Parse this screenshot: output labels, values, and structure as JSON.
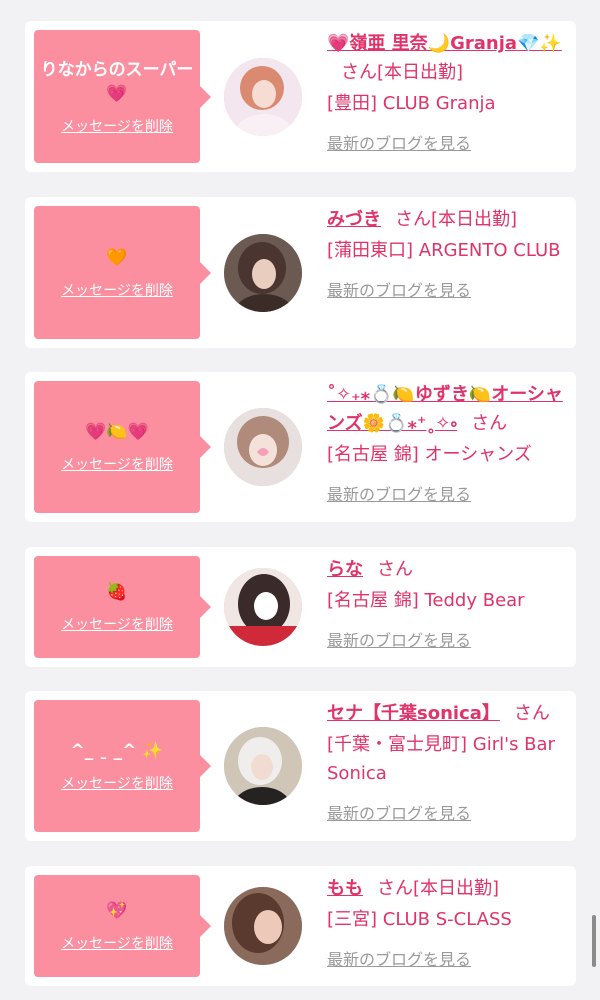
{
  "cards": [
    {
      "message": "りなからのスーパー💗",
      "delete_label": "メッセージを削除",
      "name": "💗嶺亜 里奈🌙Granja💎✨",
      "honorific": "さん",
      "status": "[本日出勤]",
      "shop": "[豊田] CLUB Granja",
      "blog_label": "最新のブログを見る",
      "avatar_icon": "profile-photo-icon"
    },
    {
      "message": "🧡",
      "delete_label": "メッセージを削除",
      "name": "みづき",
      "honorific": "さん",
      "status": "[本日出勤]",
      "shop": "[蒲田東口] ARGENTO CLUB",
      "blog_label": "最新のブログを見る",
      "avatar_icon": "profile-photo-icon"
    },
    {
      "message": "💗🍋💗",
      "delete_label": "メッセージを削除",
      "name": "˚✧₊⁎💍🍋ゆずき🍋オーシャンズ🌼💍⁎⁺˳✧༚",
      "honorific": "さん",
      "status": "",
      "shop": "[名古屋 錦] オーシャンズ",
      "blog_label": "最新のブログを見る",
      "avatar_icon": "profile-photo-icon"
    },
    {
      "message": "🍓",
      "delete_label": "メッセージを削除",
      "name": "らな",
      "honorific": "さん",
      "status": "",
      "shop": "[名古屋 錦] Teddy Bear",
      "blog_label": "最新のブログを見る",
      "avatar_icon": "profile-photo-icon"
    },
    {
      "message": "^_ ˍ _^ ✨",
      "delete_label": "メッセージを削除",
      "name": "セナ【千葉sonica】",
      "honorific": "さん",
      "status": "",
      "shop": "[千葉・富士見町] Girl's Bar Sonica",
      "blog_label": "最新のブログを見る",
      "avatar_icon": "profile-photo-icon"
    },
    {
      "message": "💖",
      "delete_label": "メッセージを削除",
      "name": "もも",
      "honorific": "さん",
      "status": "[本日出勤]",
      "shop": "[三宮] CLUB S-CLASS",
      "blog_label": "最新のブログを見る",
      "avatar_icon": "profile-photo-icon"
    }
  ],
  "colors": {
    "bubble": "#fb8fa0",
    "accent": "#e0336a",
    "link_gray": "#9a9a9a",
    "page_bg": "#f2f2f4"
  }
}
